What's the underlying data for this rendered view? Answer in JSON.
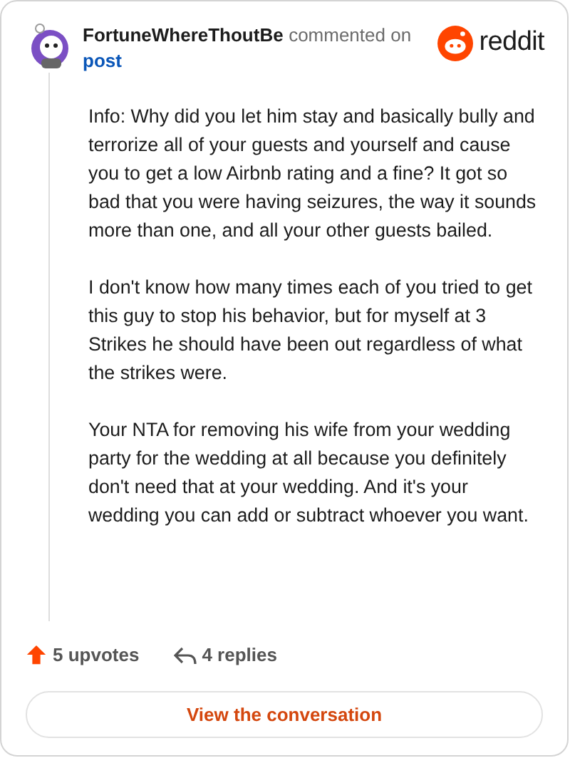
{
  "header": {
    "username": "FortuneWhereThoutBe",
    "action": "commented on",
    "link": "post",
    "brand": "reddit"
  },
  "paragraphs": [
    "Info: Why did you let him stay and basically bully and terrorize all of your guests and yourself and cause you to get a low Airbnb rating and a fine? It got so bad that you were having seizures, the way it sounds more than one, and all your other guests bailed.",
    "I don't know how many times each of you tried to get this guy to stop his behavior, but for myself at 3 Strikes he should have been out regardless of what the strikes were.",
    "Your NTA for removing his wife from your wedding party for the wedding at all because you definitely don't need that at your wedding. And it's your wedding you can add or subtract whoever you want."
  ],
  "footer": {
    "upvotes": "5 upvotes",
    "replies": "4 replies",
    "button": "View the conversation"
  }
}
